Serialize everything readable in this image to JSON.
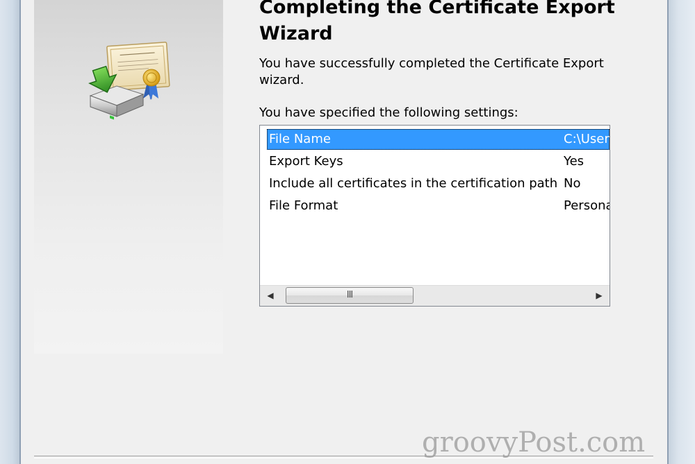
{
  "wizard": {
    "title_line1": "Completing the Certificate Export",
    "title_line2": "Wizard",
    "success_text": "You have successfully completed the Certificate Export wizard.",
    "settings_label": "You have specified the following settings:"
  },
  "settings": [
    {
      "key": "File Name",
      "value": "C:\\User",
      "selected": true
    },
    {
      "key": "Export Keys",
      "value": "Yes",
      "selected": false
    },
    {
      "key": "Include all certificates in the certification path",
      "value": "No",
      "selected": false
    },
    {
      "key": "File Format",
      "value": "Personal",
      "selected": false
    }
  ],
  "scrollbar": {
    "thumb_grip": "III",
    "left_arrow": "◀",
    "right_arrow": "▶"
  },
  "watermark": "groovyPost.com",
  "icons": {
    "banner": "certificate-export-icon"
  },
  "colors": {
    "selection": "#3399ff",
    "background": "#f0f0f0"
  }
}
